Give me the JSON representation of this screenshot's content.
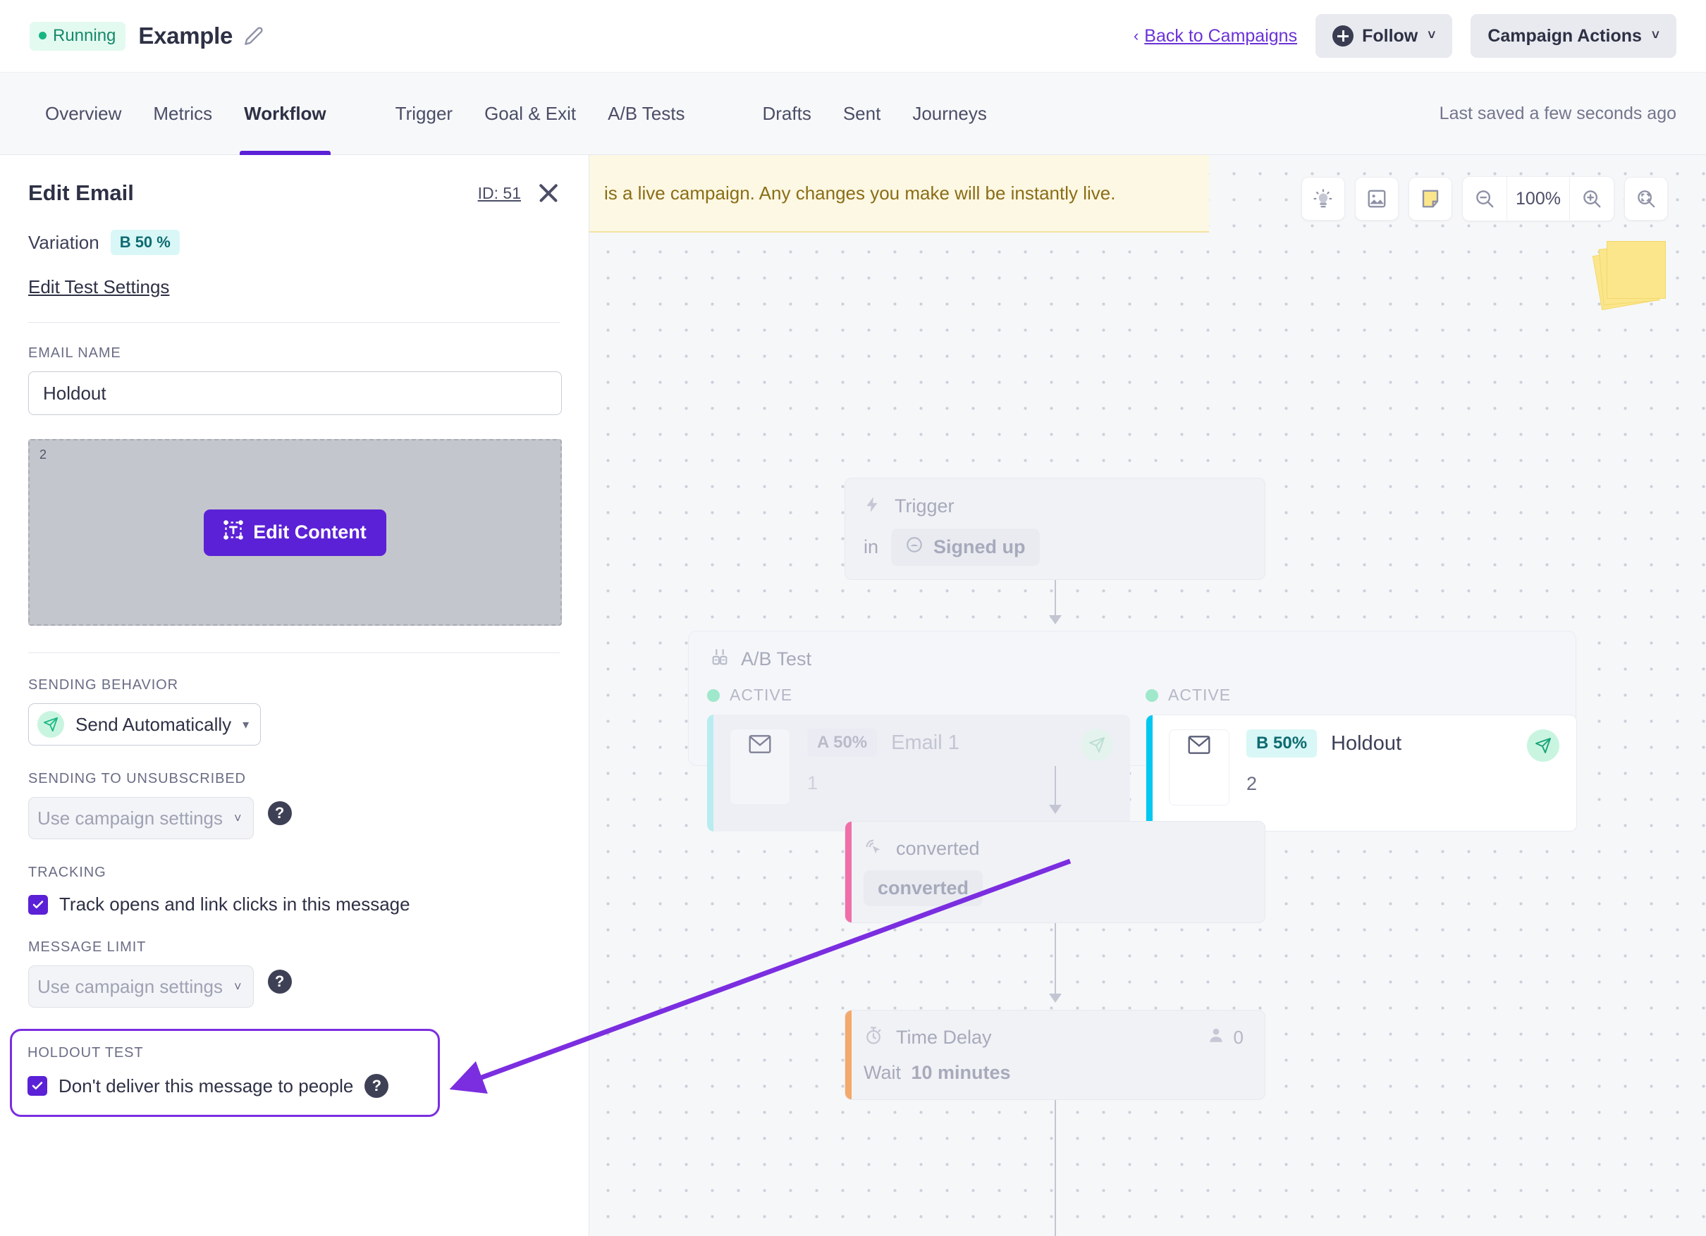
{
  "header": {
    "status": "Running",
    "campaign_title": "Example",
    "edit_title_icon": "pencil-icon",
    "back_link": "Back to Campaigns",
    "follow_button": "Follow",
    "campaign_actions_button": "Campaign Actions"
  },
  "tabs": {
    "left": [
      {
        "label": "Overview",
        "active": false
      },
      {
        "label": "Metrics",
        "active": false
      },
      {
        "label": "Workflow",
        "active": true
      }
    ],
    "middle": [
      {
        "label": "Trigger"
      },
      {
        "label": "Goal & Exit"
      },
      {
        "label": "A/B Tests"
      }
    ],
    "middle2": [
      {
        "label": "Drafts"
      },
      {
        "label": "Sent"
      },
      {
        "label": "Journeys"
      }
    ],
    "saved_status": "Last saved a few seconds ago"
  },
  "panel": {
    "title": "Edit Email",
    "id_label": "ID: 51",
    "close_icon": "close-icon",
    "variation_label": "Variation",
    "variation_chip": "B 50 %",
    "edit_test_settings": "Edit Test Settings",
    "email_name_label": "EMAIL NAME",
    "email_name_value": "Holdout",
    "preview_number": "2",
    "edit_content_button": "Edit Content",
    "sending_behavior_label": "SENDING BEHAVIOR",
    "sending_behavior_value": "Send Automatically",
    "sending_unsub_label": "SENDING TO UNSUBSCRIBED",
    "sending_unsub_value": "Use campaign settings",
    "tracking_label": "TRACKING",
    "tracking_checkbox": "Track opens and link clicks in this message",
    "message_limit_label": "MESSAGE LIMIT",
    "message_limit_value": "Use campaign settings",
    "holdout_label": "HOLDOUT TEST",
    "holdout_checkbox": "Don't deliver this message to people"
  },
  "canvas": {
    "banner": "is a live campaign. Any changes you make will be instantly live.",
    "zoom_level": "100%",
    "tools": [
      {
        "name": "lightbulb-icon"
      },
      {
        "name": "image-icon"
      },
      {
        "name": "sticky-note-icon"
      },
      {
        "name": "zoom-out-icon"
      },
      {
        "name": "zoom-in-icon"
      },
      {
        "name": "fit-to-screen-icon"
      }
    ],
    "nodes": {
      "trigger": {
        "title": "Trigger",
        "prefix": "in",
        "value": "Signed up"
      },
      "abtest": {
        "title": "A/B Test",
        "variants": [
          {
            "status": "ACTIVE",
            "chip": "A 50%",
            "name": "Email 1",
            "number": "1"
          },
          {
            "status": "ACTIVE",
            "chip": "B 50%",
            "name": "Holdout",
            "number": "2"
          }
        ]
      },
      "converted": {
        "title": "converted",
        "value": "converted"
      },
      "time_delay": {
        "title": "Time Delay",
        "prefix": "Wait",
        "value": "10 minutes",
        "count": "0"
      }
    }
  },
  "colors": {
    "accent_purple": "#5b21d6",
    "annotation_purple": "#7b2ee0",
    "status_green": "#17b583",
    "variant_b_cyan": "#00c8f0",
    "variant_a_cyan": "#b8ecf0",
    "converted_pink": "#f06fa8",
    "delay_orange": "#f4a86a",
    "banner_yellow": "#fdf8e3"
  }
}
